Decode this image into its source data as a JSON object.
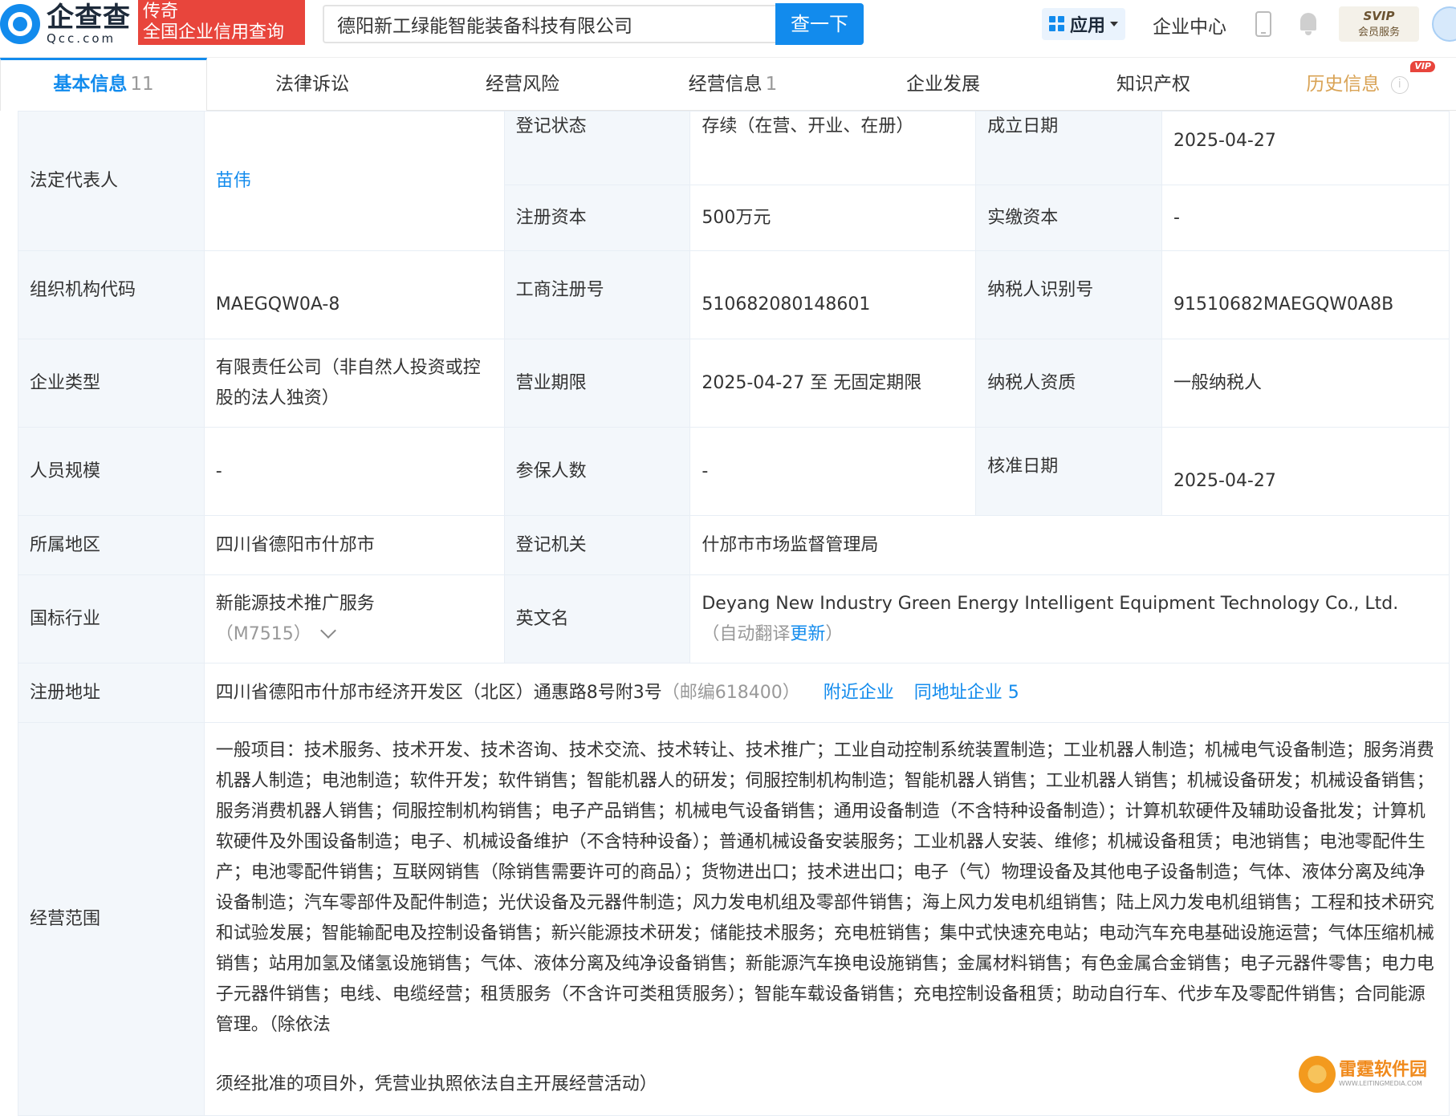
{
  "header": {
    "logo_cn": "企查查",
    "logo_en": "Qcc.com",
    "badge_line1": "传奇",
    "badge_line2": "全国企业信用查询",
    "search_value": "德阳新工绿能智能装备科技有限公司",
    "search_button": "查一下",
    "app_label": "应用",
    "enterprise_center": "企业中心",
    "svip_title": "SVIP",
    "svip_sub": "会员服务"
  },
  "tabs": [
    {
      "label": "基本信息",
      "count": "11"
    },
    {
      "label": "法律诉讼",
      "count": ""
    },
    {
      "label": "经营风险",
      "count": ""
    },
    {
      "label": "经营信息",
      "count": "1"
    },
    {
      "label": "企业发展",
      "count": ""
    },
    {
      "label": "知识产权",
      "count": ""
    },
    {
      "label": "历史信息",
      "count": "",
      "vip": "VIP"
    }
  ],
  "info": {
    "legal_rep_label": "法定代表人",
    "legal_rep_value": "苗伟",
    "reg_status_label": "登记状态",
    "reg_status_value": "存续（在营、开业、在册）",
    "est_date_label": "成立日期",
    "est_date_value": "2025-04-27",
    "reg_capital_label": "注册资本",
    "reg_capital_value": "500万元",
    "paid_capital_label": "实缴资本",
    "paid_capital_value": "-",
    "org_code_label": "组织机构代码",
    "org_code_value": "MAEGQW0A-8",
    "biz_reg_no_label": "工商注册号",
    "biz_reg_no_value": "510682080148601",
    "taxpayer_id_label": "纳税人识别号",
    "taxpayer_id_value": "91510682MAEGQW0A8B",
    "ent_type_label": "企业类型",
    "ent_type_value": "有限责任公司（非自然人投资或控股的法人独资）",
    "biz_term_label": "营业期限",
    "biz_term_value": "2025-04-27 至 无固定期限",
    "taxpayer_qual_label": "纳税人资质",
    "taxpayer_qual_value": "一般纳税人",
    "staff_size_label": "人员规模",
    "staff_size_value": "-",
    "insured_label": "参保人数",
    "insured_value": "-",
    "approval_date_label": "核准日期",
    "approval_date_value": "2025-04-27",
    "region_label": "所属地区",
    "region_value": "四川省德阳市什邡市",
    "reg_authority_label": "登记机关",
    "reg_authority_value": "什邡市市场监督管理局",
    "industry_label": "国标行业",
    "industry_value": "新能源技术推广服务",
    "industry_code": "（M7515）",
    "english_name_label": "英文名",
    "english_name_value": "Deyang New Industry Green Energy Intelligent Equipment Technology Co., Ltd.",
    "english_note_open": "（自动翻译",
    "english_update": "更新",
    "english_note_close": "）",
    "address_label": "注册地址",
    "address_value": "四川省德阳市什邡市经济开发区（北区）通惠路8号附3号",
    "address_postcode": "（邮编618400）",
    "nearby_link": "附近企业",
    "same_address_link": "同地址企业 5",
    "scope_label": "经营范围",
    "scope_value": "一般项目：技术服务、技术开发、技术咨询、技术交流、技术转让、技术推广；工业自动控制系统装置制造；工业机器人制造；机械电气设备制造；服务消费机器人制造；电池制造；软件开发；软件销售；智能机器人的研发；伺服控制机构制造；智能机器人销售；工业机器人销售；机械设备研发；机械设备销售；服务消费机器人销售；伺服控制机构销售；电子产品销售；机械电气设备销售；通用设备制造（不含特种设备制造）；计算机软硬件及辅助设备批发；计算机软硬件及外围设备制造；电子、机械设备维护（不含特种设备）；普通机械设备安装服务；工业机器人安装、维修；机械设备租赁；电池销售；电池零配件生产；电池零配件销售；互联网销售（除销售需要许可的商品）；货物进出口；技术进出口；电子（气）物理设备及其他电子设备制造；气体、液体分离及纯净设备制造；汽车零部件及配件制造；光伏设备及元器件制造；风力发电机组及零部件销售；海上风力发电机组销售；陆上风力发电机组销售；工程和技术研究和试验发展；智能输配电及控制设备销售；新兴能源技术研发；储能技术服务；充电桩销售；集中式快速充电站；电动汽车充电基础设施运营；气体压缩机械销售；站用加氢及储氢设施销售；气体、液体分离及纯净设备销售；新能源汽车换电设施销售；金属材料销售；有色金属合金销售；电子元器件零售；电力电子元器件销售；电线、电缆经营；租赁服务（不含许可类租赁服务）；智能车载设备销售；充电控制设备租赁；助动自行车、代步车及零配件销售；合同能源管理。（除依法",
    "scope_tail": "须经批准的项目外，凭营业执照依法自主开展经营活动）"
  },
  "watermark": {
    "cn": "雷霆软件园",
    "en": "WWW.LEITINGMEDIA.COM"
  }
}
